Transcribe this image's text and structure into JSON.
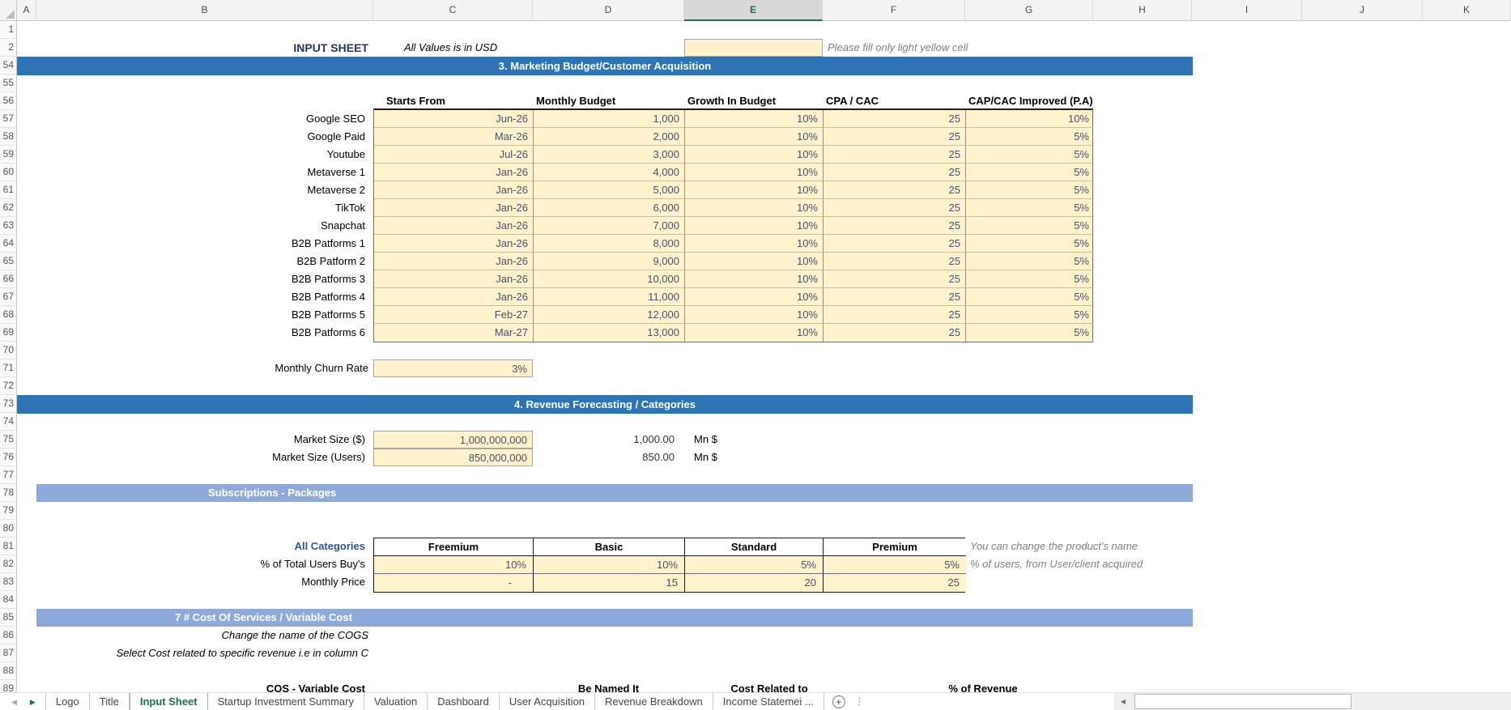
{
  "columns": {
    "letters": [
      "A",
      "B",
      "C",
      "D",
      "E",
      "F",
      "G",
      "H",
      "I",
      "J",
      "K"
    ],
    "selected": "E"
  },
  "rows": {
    "first": [
      1,
      2
    ],
    "block_start": 54,
    "block_end": 89
  },
  "header_row": {
    "title": "INPUT SHEET",
    "subtitle": "All Values is in USD",
    "input_value": "",
    "note": "Please fill only light yellow cell"
  },
  "sections": {
    "marketing": {
      "title": "3. Marketing Budget/Customer Acquisition"
    },
    "revenue": {
      "title": "4. Revenue Forecasting / Categories"
    },
    "subscriptions": {
      "title": "Subscriptions - Packages"
    },
    "cos": {
      "title": "7 # Cost Of Services / Variable Cost"
    }
  },
  "marketing_table": {
    "headers": [
      "Starts From",
      "Monthly Budget",
      "Growth In Budget",
      "CPA / CAC",
      "CAP/CAC Improved (P.A)"
    ],
    "channels": [
      {
        "row": 57,
        "name": "Google SEO",
        "starts_from": "Jun-26",
        "monthly_budget": "1,000",
        "growth": "10%",
        "cpa_cac": "25",
        "cac_improved": "10%"
      },
      {
        "row": 58,
        "name": "Google Paid",
        "starts_from": "Mar-26",
        "monthly_budget": "2,000",
        "growth": "10%",
        "cpa_cac": "25",
        "cac_improved": "5%"
      },
      {
        "row": 59,
        "name": "Youtube",
        "starts_from": "Jul-26",
        "monthly_budget": "3,000",
        "growth": "10%",
        "cpa_cac": "25",
        "cac_improved": "5%"
      },
      {
        "row": 60,
        "name": "Metaverse 1",
        "starts_from": "Jan-26",
        "monthly_budget": "4,000",
        "growth": "10%",
        "cpa_cac": "25",
        "cac_improved": "5%"
      },
      {
        "row": 61,
        "name": "Metaverse 2",
        "starts_from": "Jan-26",
        "monthly_budget": "5,000",
        "growth": "10%",
        "cpa_cac": "25",
        "cac_improved": "5%"
      },
      {
        "row": 62,
        "name": "TikTok",
        "starts_from": "Jan-26",
        "monthly_budget": "6,000",
        "growth": "10%",
        "cpa_cac": "25",
        "cac_improved": "5%"
      },
      {
        "row": 63,
        "name": "Snapchat",
        "starts_from": "Jan-26",
        "monthly_budget": "7,000",
        "growth": "10%",
        "cpa_cac": "25",
        "cac_improved": "5%"
      },
      {
        "row": 64,
        "name": "B2B Patforms 1",
        "starts_from": "Jan-26",
        "monthly_budget": "8,000",
        "growth": "10%",
        "cpa_cac": "25",
        "cac_improved": "5%"
      },
      {
        "row": 65,
        "name": "B2B Patform 2",
        "starts_from": "Jan-26",
        "monthly_budget": "9,000",
        "growth": "10%",
        "cpa_cac": "25",
        "cac_improved": "5%"
      },
      {
        "row": 66,
        "name": "B2B Patforms 3",
        "starts_from": "Jan-26",
        "monthly_budget": "10,000",
        "growth": "10%",
        "cpa_cac": "25",
        "cac_improved": "5%"
      },
      {
        "row": 67,
        "name": "B2B Patforms 4",
        "starts_from": "Jan-26",
        "monthly_budget": "11,000",
        "growth": "10%",
        "cpa_cac": "25",
        "cac_improved": "5%"
      },
      {
        "row": 68,
        "name": "B2B Patforms 5",
        "starts_from": "Feb-27",
        "monthly_budget": "12,000",
        "growth": "10%",
        "cpa_cac": "25",
        "cac_improved": "5%"
      },
      {
        "row": 69,
        "name": "B2B Patforms 6",
        "starts_from": "Mar-27",
        "monthly_budget": "13,000",
        "growth": "10%",
        "cpa_cac": "25",
        "cac_improved": "5%"
      }
    ]
  },
  "churn": {
    "label": "Monthly Churn Rate",
    "value": "3%"
  },
  "market_size": {
    "rows": [
      {
        "row": 75,
        "label": "Market Size ($)",
        "value": "1,000,000,000",
        "converted": "1,000.00",
        "unit": "Mn $"
      },
      {
        "row": 76,
        "label": "Market Size (Users)",
        "value": "850,000,000",
        "converted": "850.00",
        "unit": "Mn $"
      }
    ]
  },
  "packages": {
    "label": "All Categories",
    "product_columns": [
      "Freemium",
      "Basic",
      "Standard",
      "Premium"
    ],
    "rows": [
      {
        "row": 82,
        "label": "% of Total Users Buy's",
        "values": [
          "10%",
          "10%",
          "5%",
          "5%"
        ]
      },
      {
        "row": 83,
        "label": "Monthly Price",
        "values": [
          "-",
          "15",
          "20",
          "25"
        ]
      }
    ],
    "notes": [
      "You can change the product's name",
      "% of users, from User/client acquired"
    ]
  },
  "cos_section": {
    "note1": "Change the name of the COGS",
    "note2": "Select Cost related to specific revenue i.e in column C",
    "table_headers": [
      "COS - Variable Cost",
      "Be Named It",
      "Cost Related to",
      "% of Revenue"
    ]
  },
  "tab_bar": {
    "tabs": [
      "Logo",
      "Title",
      "Input Sheet",
      "Startup Investment Summary",
      "Valuation",
      "Dashboard",
      "User Acquisition",
      "Revenue Breakdown",
      "Income Statemei ..."
    ],
    "active_tab": "Input Sheet",
    "add_sheet": "+"
  },
  "colors": {
    "banner_dark": "#2E74B5",
    "banner_light": "#8EAADB",
    "input_fill": "#FFF2CC",
    "input_text": "#44546A",
    "title": "#1F3864",
    "category_label": "#2F5496",
    "note": "#7F7F7F",
    "active_tab": "#1E7145"
  }
}
